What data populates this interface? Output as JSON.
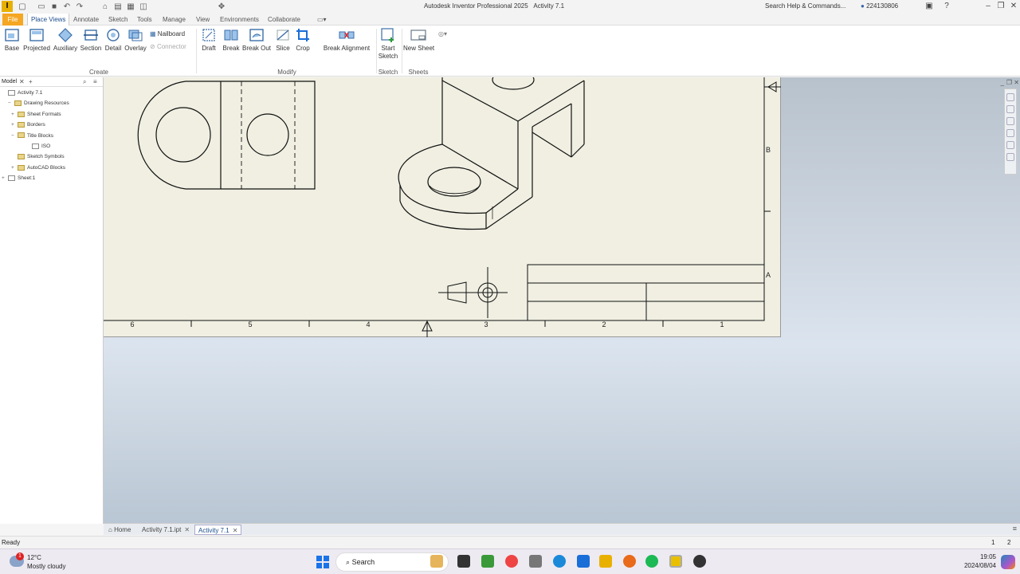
{
  "window": {
    "app_title": "Autodesk Inventor Professional 2025",
    "doc_title": "Activity 7.1",
    "search_placeholder": "Search Help & Commands...",
    "user": "224130806"
  },
  "menu": {
    "file": "File",
    "tabs": [
      "Place Views",
      "Annotate",
      "Sketch",
      "Tools",
      "Manage",
      "View",
      "Environments",
      "Collaborate"
    ],
    "active_tab": "Place Views"
  },
  "ribbon": {
    "create": {
      "label": "Create",
      "buttons": [
        "Base",
        "Projected",
        "Auxiliary",
        "Section",
        "Detail",
        "Overlay"
      ],
      "nailboard": "Nailboard",
      "connector": "Connector"
    },
    "modify": {
      "label": "Modify",
      "buttons": [
        "Draft",
        "Break",
        "Break Out",
        "Slice",
        "Crop"
      ],
      "break_alignment": "Break Alignment"
    },
    "sketch": {
      "label": "Sketch",
      "start_sketch": "Start Sketch"
    },
    "sheets": {
      "label": "Sheets",
      "new_sheet": "New Sheet"
    }
  },
  "browser": {
    "tab": "Model",
    "items": [
      {
        "label": "Activity 7.1",
        "level": 0,
        "expander": "",
        "icon": "document-icon"
      },
      {
        "label": "Drawing Resources",
        "level": 1,
        "expander": "−",
        "icon": "folder-icon"
      },
      {
        "label": "Sheet Formats",
        "level": 2,
        "expander": "+",
        "icon": "folder-icon"
      },
      {
        "label": "Borders",
        "level": 2,
        "expander": "+",
        "icon": "folder-icon"
      },
      {
        "label": "Title Blocks",
        "level": 2,
        "expander": "−",
        "icon": "folder-icon"
      },
      {
        "label": "ISO",
        "level": 3,
        "expander": "",
        "icon": "title-block-icon"
      },
      {
        "label": "Sketch Symbols",
        "level": 2,
        "expander": "",
        "icon": "folder-icon"
      },
      {
        "label": "AutoCAD Blocks",
        "level": 2,
        "expander": "+",
        "icon": "folder-icon"
      },
      {
        "label": "Sheet:1",
        "level": 0,
        "expander": "+",
        "icon": "sheet-icon"
      }
    ]
  },
  "drawing": {
    "zone_numbers": [
      "6",
      "5",
      "4",
      "3",
      "2",
      "1"
    ],
    "zone_letters": [
      "B",
      "A"
    ]
  },
  "doc_tabs": {
    "home": "Home",
    "tabs": [
      "Activity 7.1.ipt",
      "Activity 7.1"
    ],
    "active": "Activity 7.1"
  },
  "status": {
    "text": "Ready",
    "num1": "1",
    "num2": "2"
  },
  "taskbar": {
    "weather_temp": "12°C",
    "weather_desc": "Mostly cloudy",
    "weather_badge": "1",
    "search": "Search",
    "time": "19:05",
    "date": "2024/08/04"
  }
}
